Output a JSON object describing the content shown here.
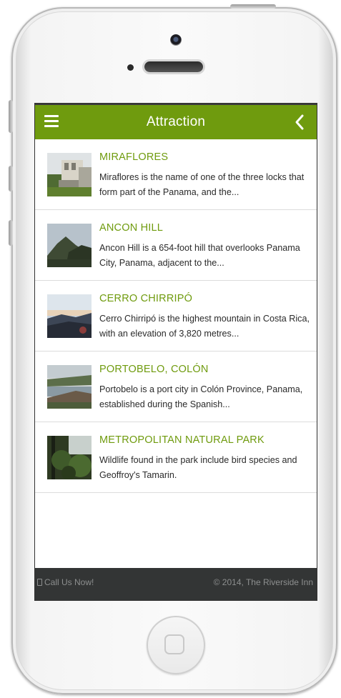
{
  "app": {
    "title": "Attraction",
    "menu_icon": "hamburger-menu-icon",
    "back_icon": "chevron-left-icon",
    "accent_color": "#6f9b0e"
  },
  "attractions": [
    {
      "title": "MIRAFLORES",
      "description": "Miraflores is the name of one of the three locks that form part of the Panama, and the...",
      "thumbnail": "miraflores-locks-photo"
    },
    {
      "title": "ANCON HILL",
      "description": "Ancon Hill is a 654-foot hill that overlooks Panama City, Panama, adjacent to the...",
      "thumbnail": "ancon-hill-photo"
    },
    {
      "title": "CERRO CHIRRIPÓ",
      "description": "Cerro Chirripó is the highest mountain in Costa Rica, with an elevation of 3,820 metres...",
      "thumbnail": "cerro-chirripo-photo"
    },
    {
      "title": "PORTOBELO, COLÓN",
      "description": "Portobelo is a port city in Colón Province, Panama, established during the Spanish...",
      "thumbnail": "portobelo-photo"
    },
    {
      "title": "METROPOLITAN NATURAL PARK",
      "description": "Wildlife found in the park include bird species and Geoffroy's Tamarin.",
      "thumbnail": "metropolitan-park-photo"
    }
  ],
  "footer": {
    "call_label": "Call Us Now!",
    "call_icon": "phone-icon",
    "copyright": "© 2014, The Riverside Inn",
    "background": "#333535"
  }
}
